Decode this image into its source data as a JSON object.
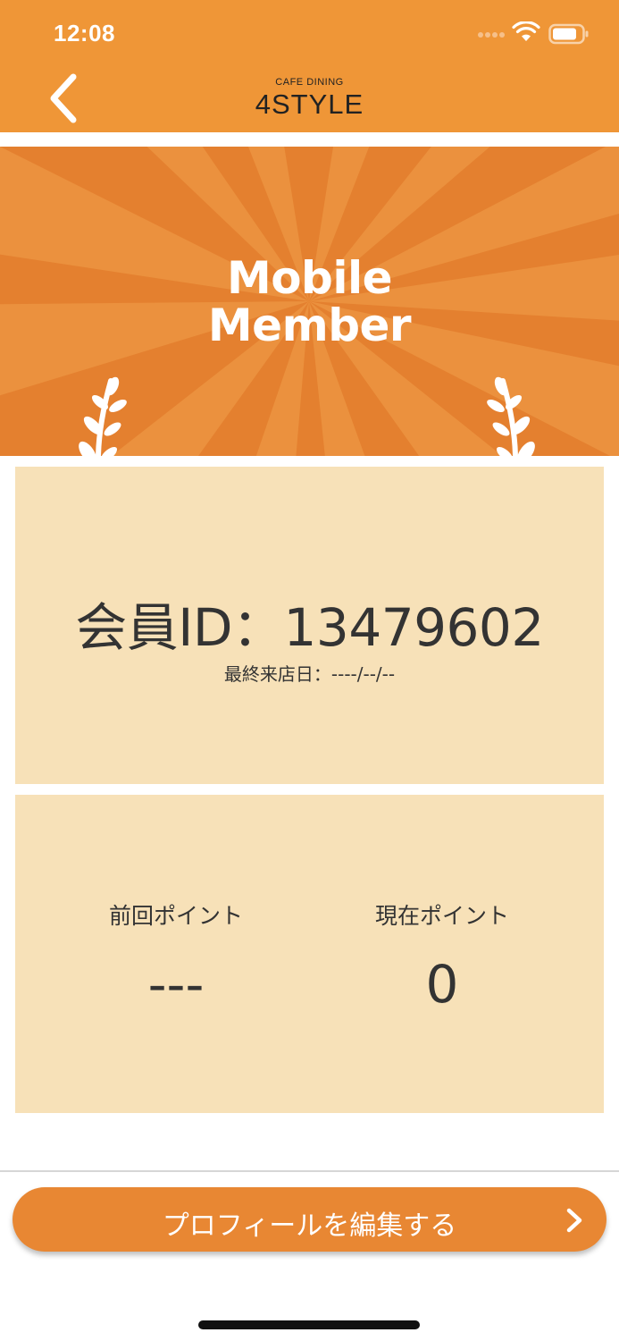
{
  "status_bar": {
    "time": "12:08"
  },
  "header": {
    "logo_small": "CAFE DINING",
    "logo_big": "4STYLE",
    "back_icon": "chevron-left-icon"
  },
  "banner": {
    "line1": "Mobile",
    "line2": "Member",
    "colors": {
      "base": "#e4802f",
      "ray": "#eb913e"
    }
  },
  "member": {
    "id_text": "会員ID：13479602",
    "last_visit": "最終来店日：----/--/--"
  },
  "points": {
    "previous_label": "前回ポイント",
    "previous_value": "---",
    "current_label": "現在ポイント",
    "current_value": "0"
  },
  "footer": {
    "edit_button_label": "プロフィールを編集する",
    "chevron_icon": "chevron-right-icon"
  },
  "colors": {
    "header": "#ef9637",
    "card": "#f7e1b8",
    "button": "#e88733"
  }
}
